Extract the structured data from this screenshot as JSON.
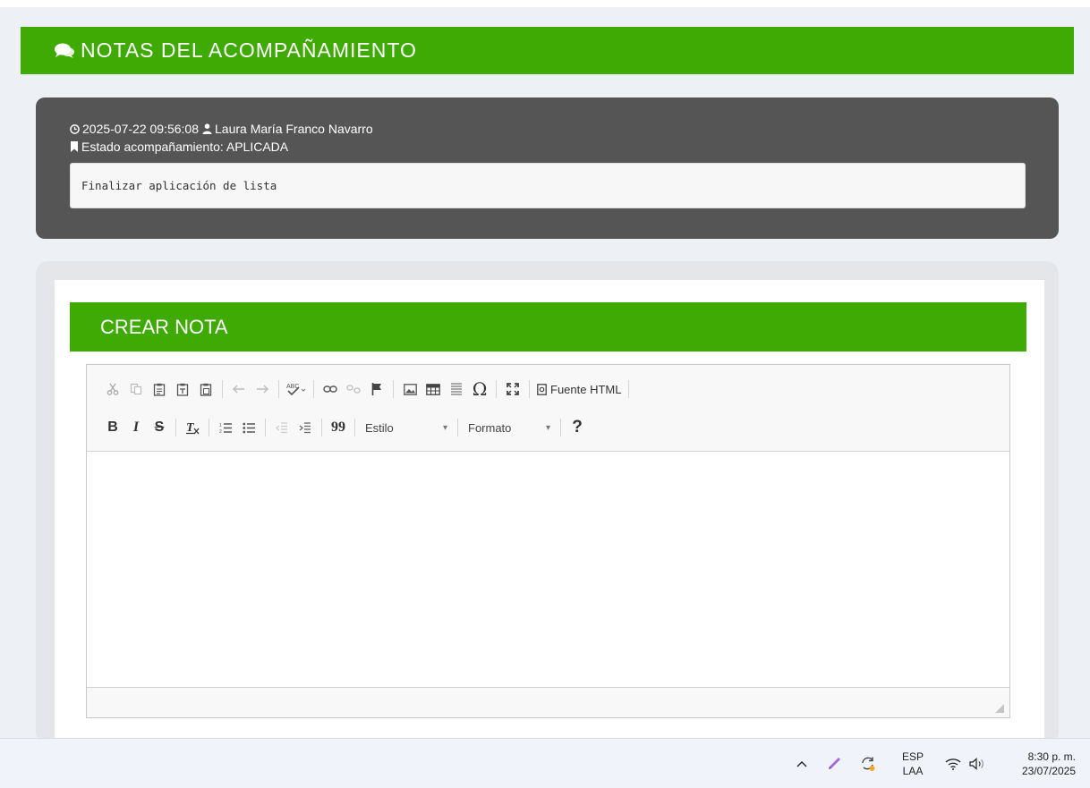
{
  "notes_section": {
    "title": "NOTAS DEL ACOMPAÑAMIENTO",
    "icon": "comments-icon"
  },
  "note": {
    "timestamp": "2025-07-22 09:56:08",
    "author": "Laura María Franco Navarro",
    "status_label": "Estado acompañamiento: APLICADA",
    "body": "Finalizar aplicación de lista"
  },
  "create_note": {
    "title": "CREAR NOTA",
    "toolbar": {
      "source_html": "Fuente HTML",
      "style_combo": "Estilo",
      "format_combo": "Formato",
      "help": "?",
      "bold": "B",
      "italic": "I",
      "strike": "S",
      "blockquote": "99",
      "special_char": "Ω"
    },
    "editor_content": ""
  },
  "taskbar": {
    "lang_top": "ESP",
    "lang_bottom": "LAA",
    "time": "8:30 p. m.",
    "date": "23/07/2025"
  },
  "colors": {
    "accent_green": "#3faa04",
    "note_card": "#555555",
    "page_bg": "#edf0f5"
  }
}
